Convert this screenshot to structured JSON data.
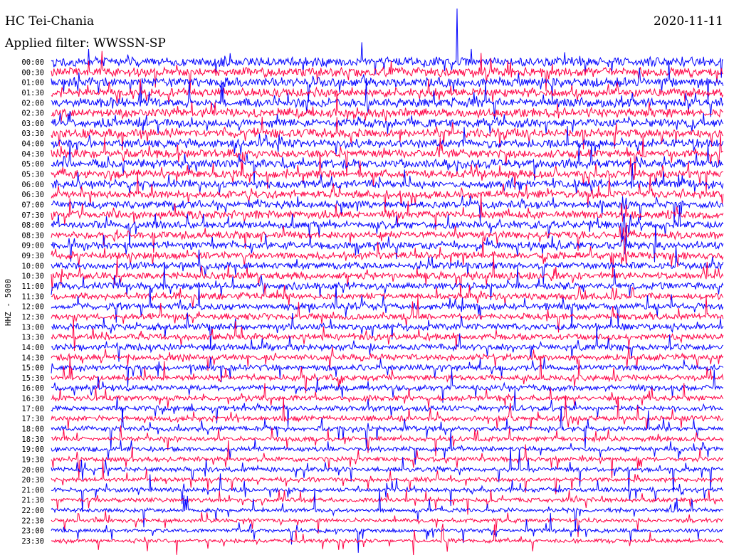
{
  "header": {
    "station": "HC Tei-Chania",
    "date": "2020-11-11",
    "filter": "Applied filter: WWSSN-SP"
  },
  "chart_data": {
    "type": "line",
    "title": "HC Tei-Chania",
    "ylabel": "HHZ - 5000",
    "y_ticks": [
      "00:00",
      "00:30",
      "01:00",
      "01:30",
      "02:00",
      "02:30",
      "03:00",
      "03:30",
      "04:00",
      "04:30",
      "05:00",
      "05:30",
      "06:00",
      "06:30",
      "07:00",
      "07:30",
      "08:00",
      "08:30",
      "09:00",
      "09:30",
      "10:00",
      "10:30",
      "11:00",
      "11:30",
      "12:00",
      "12:30",
      "13:00",
      "13:30",
      "14:00",
      "14:30",
      "15:00",
      "15:30",
      "16:00",
      "16:30",
      "17:00",
      "17:30",
      "18:00",
      "18:30",
      "19:00",
      "19:30",
      "20:00",
      "20:30",
      "21:00",
      "21:30",
      "22:00",
      "22:30",
      "23:00",
      "23:30"
    ],
    "trace_colors": [
      "#0000ff",
      "#ff0044"
    ],
    "grid": false
  }
}
